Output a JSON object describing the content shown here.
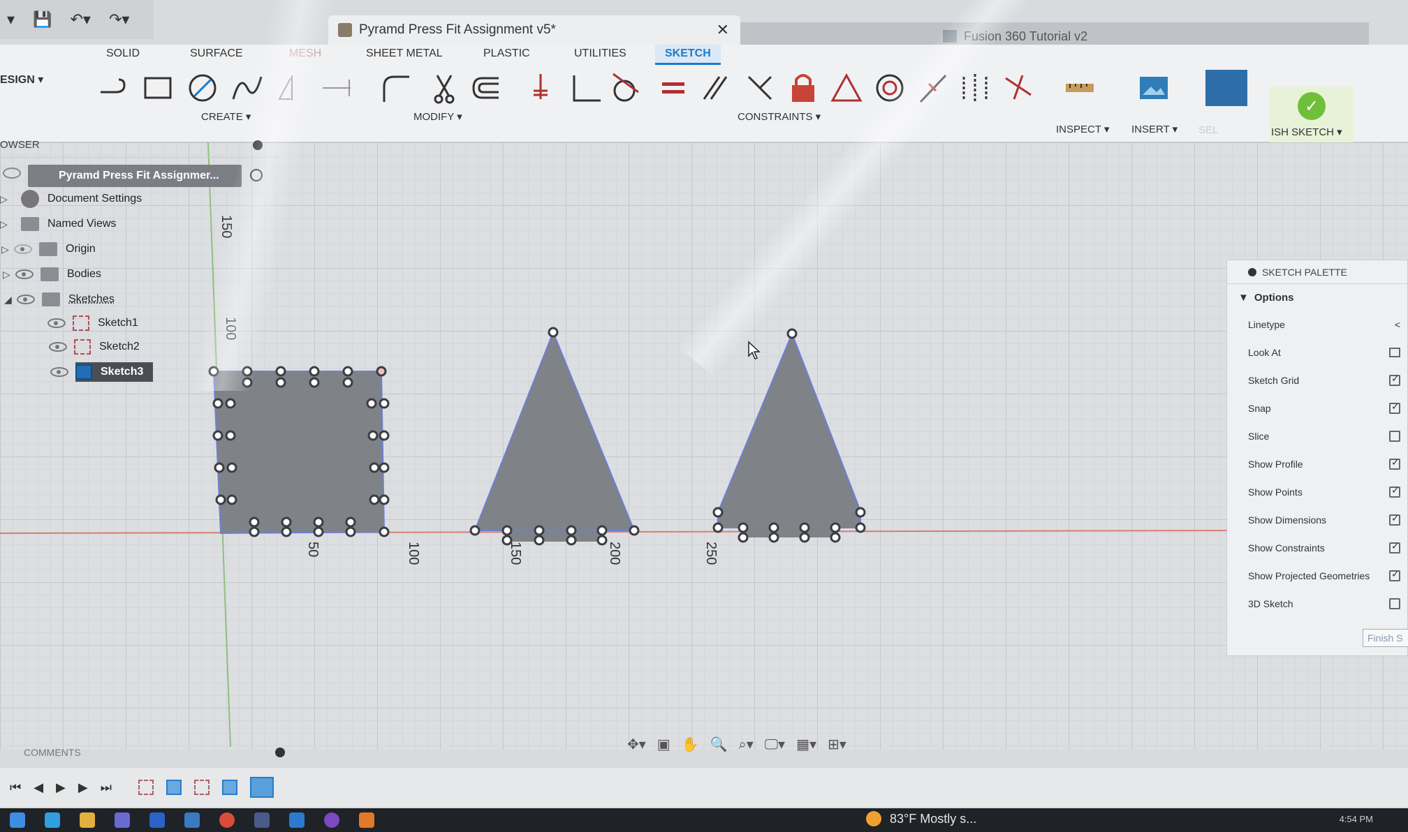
{
  "window": {
    "doc_tab_title": "Pyramd Press Fit Assignment v5*",
    "second_tab_title": "Fusion 360 Tutorial v2",
    "close_glyph": "✕"
  },
  "ribbon": {
    "workspace": "ESIGN ▾",
    "tabs": [
      "SOLID",
      "SURFACE",
      "MESH",
      "SHEET METAL",
      "PLASTIC",
      "UTILITIES",
      "SKETCH"
    ],
    "active_tab": "SKETCH",
    "groups": {
      "create": "CREATE ▾",
      "modify": "MODIFY ▾",
      "constraints": "CONSTRAINTS ▾",
      "inspect": "INSPECT ▾",
      "insert": "INSERT ▾",
      "select": "SEL",
      "finish": "ISH SKETCH ▾"
    }
  },
  "browser": {
    "title": "OWSER",
    "root": "Pyramd Press Fit Assignmer...",
    "items": [
      {
        "label": "Document Settings",
        "icon": "gear-icon"
      },
      {
        "label": "Named Views",
        "icon": "folder-icon"
      },
      {
        "label": "Origin",
        "icon": "folder-icon"
      },
      {
        "label": "Bodies",
        "icon": "folder-icon"
      },
      {
        "label": "Sketches",
        "icon": "folder-icon"
      }
    ],
    "sketches": [
      "Sketch1",
      "Sketch2",
      "Sketch3"
    ],
    "active_sketch": "Sketch3"
  },
  "canvas": {
    "axis_labels_vertical": [
      "150",
      "100"
    ],
    "axis_labels_horizontal": [
      "50",
      "100",
      "150",
      "200",
      "250"
    ]
  },
  "palette": {
    "title": "SKETCH PALETTE",
    "section": "Options",
    "options": [
      {
        "label": "Linetype",
        "checked": null
      },
      {
        "label": "Look At",
        "checked": null
      },
      {
        "label": "Sketch Grid",
        "checked": true
      },
      {
        "label": "Snap",
        "checked": true
      },
      {
        "label": "Slice",
        "checked": false
      },
      {
        "label": "Show Profile",
        "checked": true
      },
      {
        "label": "Show Points",
        "checked": true
      },
      {
        "label": "Show Dimensions",
        "checked": true
      },
      {
        "label": "Show Constraints",
        "checked": true
      },
      {
        "label": "Show Projected Geometries",
        "checked": true
      },
      {
        "label": "3D Sketch",
        "checked": false
      }
    ],
    "finish_button": "Finish S"
  },
  "comments": {
    "title": "COMMENTS"
  },
  "taskbar": {
    "weather": "83°F  Mostly s...",
    "clock": "4:54 PM"
  },
  "colors": {
    "sketch_fill": "#7f8388",
    "sketch_edge": "#6b7fd6",
    "x_axis": "#d97f6f",
    "y_axis": "#8fbf7f",
    "accent": "#1a7bc9"
  }
}
